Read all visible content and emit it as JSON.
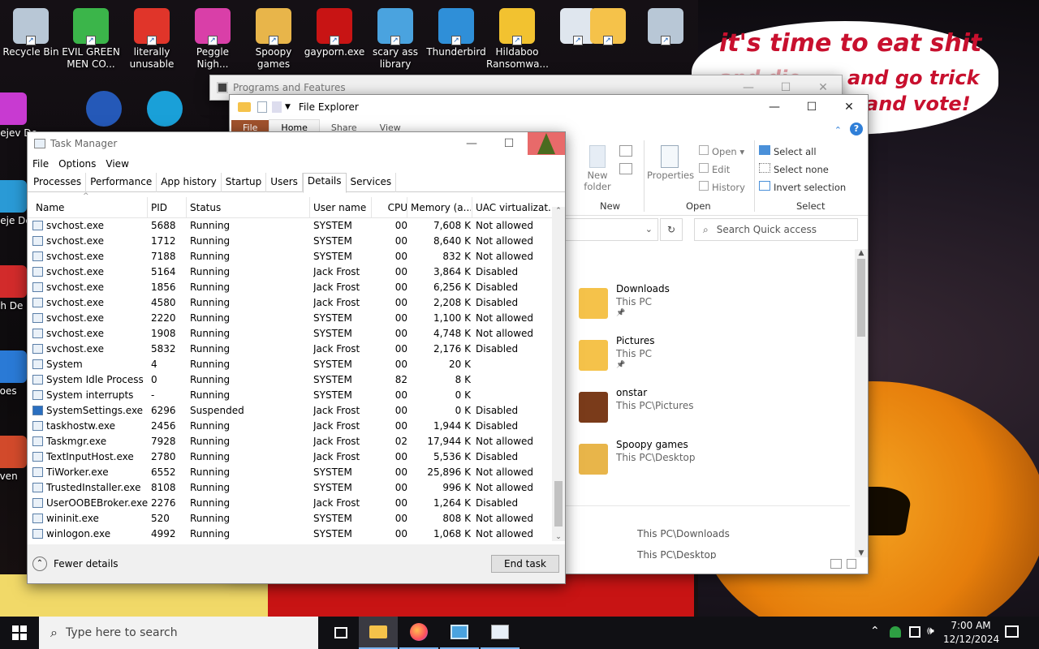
{
  "desktop": {
    "icons": [
      {
        "label": "Recycle Bin",
        "icon": "recycle-bin-icon",
        "color": "#b8c7d6"
      },
      {
        "label": "EVIL GREEN MEN CO...",
        "icon": "green-men-icon",
        "color": "#3bb54a"
      },
      {
        "label": "literally unusable",
        "icon": "chrome-icon",
        "color": "#e0352a"
      },
      {
        "label": "Peggle Nigh...",
        "icon": "peggle-icon",
        "color": "#d93fa8"
      },
      {
        "label": "Spoopy games",
        "icon": "folder-icon",
        "color": "#e8b54a"
      },
      {
        "label": "gayporn.exe",
        "icon": "flash-icon",
        "color": "#c81414"
      },
      {
        "label": "scary ass library",
        "icon": "network-icon",
        "color": "#4aa3df"
      },
      {
        "label": "Thunderbird",
        "icon": "control-panel-icon",
        "color": "#2f8fd8"
      },
      {
        "label": "Hildaboo Ransomwa...",
        "icon": "shield-icon",
        "color": "#f2c230"
      },
      {
        "label": "",
        "icon": "drive-icon",
        "color": "#dfe6ee"
      },
      {
        "label": "",
        "icon": "folder-icon",
        "color": "#f5c24a"
      },
      {
        "label": "",
        "icon": "recycle-bin-icon",
        "color": "#b8c7d6"
      }
    ],
    "left_icons": [
      {
        "label": "Bejev De",
        "icon": "bejeweled-icon",
        "color": "#c83ad1"
      },
      {
        "label": "Beje De",
        "icon": "bejeweled-icon",
        "color": "#2a9ad6"
      },
      {
        "label": "Ch De",
        "icon": "chuzzle-icon",
        "color": "#d22b2b"
      },
      {
        "label": "does",
        "icon": "app-icon",
        "color": "#2a7ad6"
      },
      {
        "label": "Even",
        "icon": "app-icon",
        "color": "#d24a2b"
      }
    ],
    "row2": [
      {
        "label": "",
        "icon": "mp-icon",
        "color": "#2559b8"
      },
      {
        "label": "",
        "icon": "edge-icon",
        "color": "#1aa0d8"
      }
    ],
    "speech": {
      "line1": "it's time to eat shit",
      "line2": "and go trick",
      "line3": "and vote!",
      "line2_prefix": "and die"
    }
  },
  "programs_features": {
    "title": "Programs and Features"
  },
  "file_explorer": {
    "title": "File Explorer",
    "tabs": [
      "File",
      "Home",
      "Share",
      "View"
    ],
    "ribbon": {
      "new_folder": "New folder",
      "new_group": "New",
      "properties": "Properties",
      "open": "Open",
      "edit": "Edit",
      "history": "History",
      "open_group": "Open",
      "select_all": "Select all",
      "select_none": "Select none",
      "invert": "Invert selection",
      "select_group": "Select"
    },
    "search_placeholder": "Search Quick access",
    "items": [
      {
        "name": "Downloads",
        "path": "This PC",
        "icon": "downloads-folder-icon",
        "pinned": true
      },
      {
        "name": "Pictures",
        "path": "This PC",
        "icon": "pictures-folder-icon",
        "pinned": true
      },
      {
        "name": "onstar",
        "path": "This PC\\Pictures",
        "icon": "image-folder-icon",
        "pinned": false
      },
      {
        "name": "Spoopy games",
        "path": "This PC\\Desktop",
        "icon": "games-folder-icon",
        "pinned": false
      }
    ],
    "recent": [
      "This PC\\Downloads",
      "This PC\\Desktop"
    ]
  },
  "task_manager": {
    "title": "Task Manager",
    "menu": [
      "File",
      "Options",
      "View"
    ],
    "tabs": [
      "Processes",
      "Performance",
      "App history",
      "Startup",
      "Users",
      "Details",
      "Services"
    ],
    "active_tab": "Details",
    "columns": [
      "Name",
      "PID",
      "Status",
      "User name",
      "CPU",
      "Memory (a...",
      "UAC virtualizat..."
    ],
    "rows": [
      [
        "svchost.exe",
        "5688",
        "Running",
        "SYSTEM",
        "00",
        "7,608 K",
        "Not allowed"
      ],
      [
        "svchost.exe",
        "1712",
        "Running",
        "SYSTEM",
        "00",
        "8,640 K",
        "Not allowed"
      ],
      [
        "svchost.exe",
        "7188",
        "Running",
        "SYSTEM",
        "00",
        "832 K",
        "Not allowed"
      ],
      [
        "svchost.exe",
        "5164",
        "Running",
        "Jack Frost",
        "00",
        "3,864 K",
        "Disabled"
      ],
      [
        "svchost.exe",
        "1856",
        "Running",
        "Jack Frost",
        "00",
        "6,256 K",
        "Disabled"
      ],
      [
        "svchost.exe",
        "4580",
        "Running",
        "Jack Frost",
        "00",
        "2,208 K",
        "Disabled"
      ],
      [
        "svchost.exe",
        "2220",
        "Running",
        "SYSTEM",
        "00",
        "1,100 K",
        "Not allowed"
      ],
      [
        "svchost.exe",
        "1908",
        "Running",
        "SYSTEM",
        "00",
        "4,748 K",
        "Not allowed"
      ],
      [
        "svchost.exe",
        "5832",
        "Running",
        "Jack Frost",
        "00",
        "2,176 K",
        "Disabled"
      ],
      [
        "System",
        "4",
        "Running",
        "SYSTEM",
        "00",
        "20 K",
        ""
      ],
      [
        "System Idle Process",
        "0",
        "Running",
        "SYSTEM",
        "82",
        "8 K",
        ""
      ],
      [
        "System interrupts",
        "-",
        "Running",
        "SYSTEM",
        "00",
        "0 K",
        ""
      ],
      [
        "SystemSettings.exe",
        "6296",
        "Suspended",
        "Jack Frost",
        "00",
        "0 K",
        "Disabled"
      ],
      [
        "taskhostw.exe",
        "2456",
        "Running",
        "Jack Frost",
        "00",
        "1,944 K",
        "Disabled"
      ],
      [
        "Taskmgr.exe",
        "7928",
        "Running",
        "Jack Frost",
        "02",
        "17,944 K",
        "Not allowed"
      ],
      [
        "TextInputHost.exe",
        "2780",
        "Running",
        "Jack Frost",
        "00",
        "5,536 K",
        "Disabled"
      ],
      [
        "TiWorker.exe",
        "6552",
        "Running",
        "SYSTEM",
        "00",
        "25,896 K",
        "Not allowed"
      ],
      [
        "TrustedInstaller.exe",
        "8108",
        "Running",
        "SYSTEM",
        "00",
        "996 K",
        "Not allowed"
      ],
      [
        "UserOOBEBroker.exe",
        "2276",
        "Running",
        "Jack Frost",
        "00",
        "1,264 K",
        "Disabled"
      ],
      [
        "wininit.exe",
        "520",
        "Running",
        "SYSTEM",
        "00",
        "808 K",
        "Not allowed"
      ],
      [
        "winlogon.exe",
        "4992",
        "Running",
        "SYSTEM",
        "00",
        "1,068 K",
        "Not allowed"
      ]
    ],
    "row_icons": [
      "service-icon",
      "service-icon",
      "service-icon",
      "service-icon",
      "service-icon",
      "service-icon",
      "service-icon",
      "service-icon",
      "service-icon",
      "service-icon",
      "service-icon",
      "service-icon",
      "settings-gear-icon",
      "service-icon",
      "taskmgr-icon",
      "service-icon",
      "service-icon",
      "service-icon",
      "service-icon",
      "service-icon",
      "service-icon"
    ],
    "fewer_details": "Fewer details",
    "end_task": "End task"
  },
  "taskbar": {
    "search_placeholder": "Type here to search",
    "time": "7:00 AM",
    "date": "12/12/2024",
    "apps": [
      "task-view-icon",
      "file-explorer-icon",
      "firefox-icon",
      "control-panel-icon",
      "task-manager-icon"
    ]
  }
}
